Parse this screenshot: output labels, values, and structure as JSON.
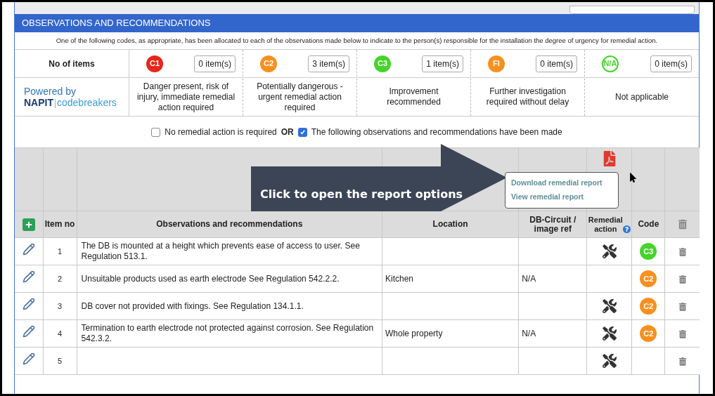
{
  "section": {
    "title": "OBSERVATIONS AND RECOMMENDATIONS",
    "intro": "One of the following codes, as appropriate, has been allocated to each of the observations made below to indicate to the person(s) responsible for the installation the degree of urgency for remedial action."
  },
  "code_legend": {
    "label": "No of items",
    "brand": {
      "line1": "Powered by",
      "name": "NAPIT",
      "product": "codebreakers"
    },
    "codes": [
      {
        "code": "C1",
        "kind": "filled",
        "color": "#e8261b",
        "count": "0 item(s)",
        "description": "Danger present, risk of injury, immediate remedial action required"
      },
      {
        "code": "C2",
        "kind": "filled",
        "color": "#f7901e",
        "count": "3 item(s)",
        "description": "Potentially dangerous - urgent remedial action required"
      },
      {
        "code": "C3",
        "kind": "filled",
        "color": "#45d42a",
        "count": "1 item(s)",
        "description": "Improvement recommended"
      },
      {
        "code": "FI",
        "kind": "filled",
        "color": "#f7901e",
        "count": "0 item(s)",
        "description": "Further investigation required without delay"
      },
      {
        "code": "N/A",
        "kind": "outline",
        "color": "#45d42a",
        "count": "0 item(s)",
        "description": "Not applicable"
      }
    ]
  },
  "declaration": {
    "options": [
      {
        "label": "No remedial action is required",
        "checked": false
      },
      {
        "label": "The following observations and recommendations have been made",
        "checked": true
      }
    ],
    "joiner": "OR"
  },
  "report_menu": {
    "items": [
      "Download remedial report",
      "View remedial report"
    ]
  },
  "callout": "Click to open the report options",
  "table": {
    "columns": [
      "Item no",
      "Observations and recommendations",
      "Location",
      "DB-Circuit / image ref",
      "Remedial action",
      "Code"
    ],
    "rows": [
      {
        "item": "1",
        "observation": "The DB is mounted at a height which prevents ease of access to user. See Regulation 513.1.",
        "location": "",
        "db_ref": "",
        "remedial": true,
        "code": "C3"
      },
      {
        "item": "2",
        "observation": "Unsuitable products used as earth electrode See Regulation 542.2.2.",
        "location": "Kitchen",
        "db_ref": "N/A",
        "remedial": false,
        "code": "C2"
      },
      {
        "item": "3",
        "observation": "DB cover not provided with fixings. See Regulation 134.1.1.",
        "location": "",
        "db_ref": "",
        "remedial": true,
        "code": "C2"
      },
      {
        "item": "4",
        "observation": "Termination to earth electrode not protected against corrosion. See Regulation 542.3.2.",
        "location": "Whole property",
        "db_ref": "N/A",
        "remedial": true,
        "code": "C2"
      },
      {
        "item": "5",
        "observation": "",
        "location": "",
        "db_ref": "",
        "remedial": true,
        "code": ""
      }
    ]
  }
}
